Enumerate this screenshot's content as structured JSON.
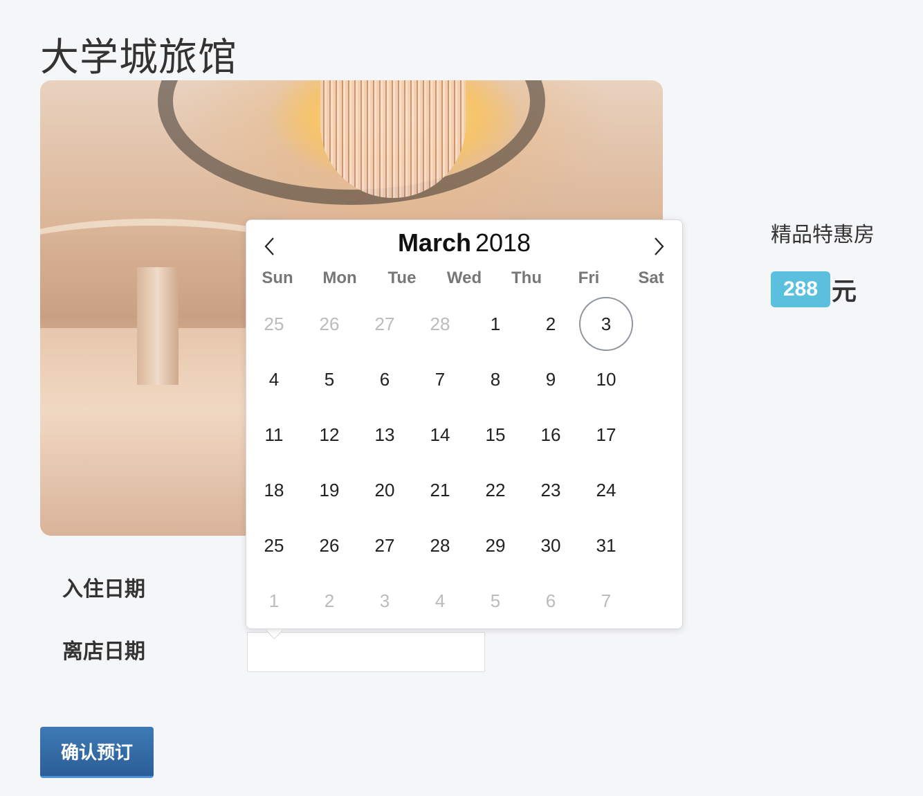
{
  "hotel": {
    "name": "大学城旅馆"
  },
  "form": {
    "checkin_label": "入住日期",
    "checkout_label": "离店日期",
    "checkout_value": "",
    "confirm_label": "确认预订"
  },
  "room": {
    "name": "精品特惠房",
    "price": "288",
    "unit": "元",
    "badge_color": "#5bc0de"
  },
  "datepicker": {
    "month": "March",
    "year": "2018",
    "prev_icon": "chevron-left-icon",
    "next_icon": "chevron-right-icon",
    "weekdays": [
      "Sun",
      "Mon",
      "Tue",
      "Wed",
      "Thu",
      "Fri",
      "Sat"
    ],
    "days": [
      {
        "label": "25",
        "muted": true
      },
      {
        "label": "26",
        "muted": true
      },
      {
        "label": "27",
        "muted": true
      },
      {
        "label": "28",
        "muted": true
      },
      {
        "label": "1"
      },
      {
        "label": "2"
      },
      {
        "label": "3",
        "today": true
      },
      {
        "label": "4"
      },
      {
        "label": "5"
      },
      {
        "label": "6"
      },
      {
        "label": "7"
      },
      {
        "label": "8"
      },
      {
        "label": "9"
      },
      {
        "label": "10"
      },
      {
        "label": "11"
      },
      {
        "label": "12"
      },
      {
        "label": "13"
      },
      {
        "label": "14"
      },
      {
        "label": "15"
      },
      {
        "label": "16"
      },
      {
        "label": "17"
      },
      {
        "label": "18"
      },
      {
        "label": "19"
      },
      {
        "label": "20"
      },
      {
        "label": "21"
      },
      {
        "label": "22"
      },
      {
        "label": "23"
      },
      {
        "label": "24"
      },
      {
        "label": "25"
      },
      {
        "label": "26"
      },
      {
        "label": "27"
      },
      {
        "label": "28"
      },
      {
        "label": "29"
      },
      {
        "label": "30"
      },
      {
        "label": "31"
      },
      {
        "label": "1",
        "muted": true
      },
      {
        "label": "2",
        "muted": true
      },
      {
        "label": "3",
        "muted": true
      },
      {
        "label": "4",
        "muted": true
      },
      {
        "label": "5",
        "muted": true
      },
      {
        "label": "6",
        "muted": true
      },
      {
        "label": "7",
        "muted": true
      }
    ]
  }
}
